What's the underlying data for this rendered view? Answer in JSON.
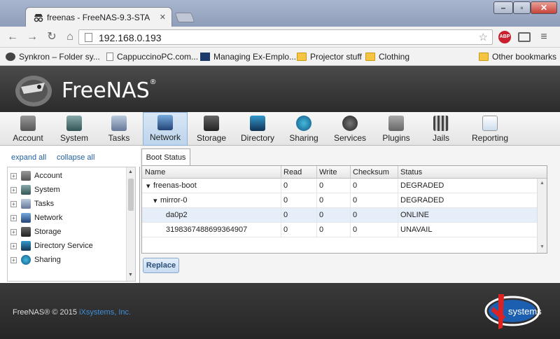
{
  "browser": {
    "tab_title": "freenas - FreeNAS-9.3-STA",
    "url": "192.168.0.193",
    "bookmarks": [
      "Synkron – Folder sy...",
      "CappuccinoPC.com...",
      "Managing Ex-Emplo...",
      "Projector stuff",
      "Clothing",
      "Other bookmarks"
    ]
  },
  "app": {
    "logo": "FreeNAS",
    "nav": [
      "Account",
      "System",
      "Tasks",
      "Network",
      "Storage",
      "Directory",
      "Sharing",
      "Services",
      "Plugins",
      "Jails",
      "Reporting"
    ],
    "active_nav": "Network"
  },
  "sidebar": {
    "expand_all": "expand all",
    "collapse_all": "collapse all",
    "items": [
      "Account",
      "System",
      "Tasks",
      "Network",
      "Storage",
      "Directory Service",
      "Sharing"
    ]
  },
  "content": {
    "tab": "Boot Status",
    "columns": [
      "Name",
      "Read",
      "Write",
      "Checksum",
      "Status"
    ],
    "rows": [
      {
        "name": "freenas-boot",
        "read": "0",
        "write": "0",
        "checksum": "0",
        "status": "DEGRADED"
      },
      {
        "name": "mirror-0",
        "read": "0",
        "write": "0",
        "checksum": "0",
        "status": "DEGRADED"
      },
      {
        "name": "da0p2",
        "read": "0",
        "write": "0",
        "checksum": "0",
        "status": "ONLINE"
      },
      {
        "name": "3198367488699364907",
        "read": "0",
        "write": "0",
        "checksum": "0",
        "status": "UNAVAIL"
      }
    ],
    "replace_button": "Replace"
  },
  "footer": {
    "copyright_prefix": "FreeNAS® © 2015",
    "company": "iXsystems, Inc.",
    "logo_text": "systems"
  }
}
